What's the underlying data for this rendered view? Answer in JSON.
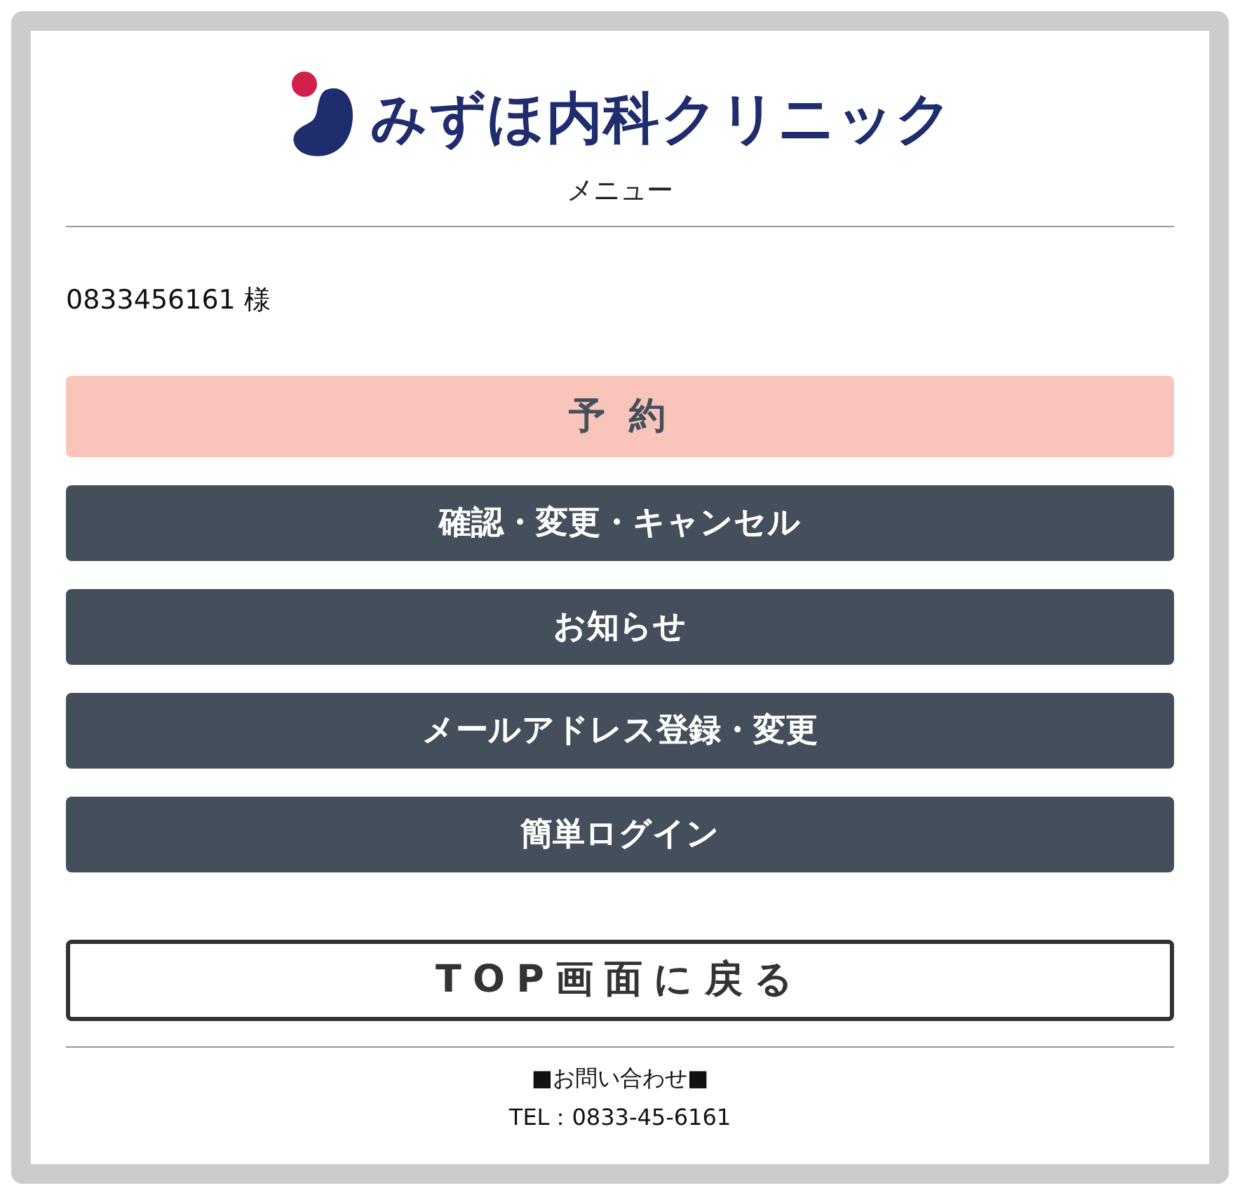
{
  "logo": {
    "name": "みずほ内科クリニック"
  },
  "page_title": "メニュー",
  "user": "0833456161 様",
  "menu": [
    {
      "label": "予 約",
      "kind": "primary"
    },
    {
      "label": "確認・変更・キャンセル",
      "kind": "secondary"
    },
    {
      "label": "お知らせ",
      "kind": "secondary"
    },
    {
      "label": "メールアドレス登録・変更",
      "kind": "secondary"
    },
    {
      "label": "簡単ログイン",
      "kind": "secondary"
    }
  ],
  "top_button": {
    "label": "TOP画面に戻る",
    "kind": "outline"
  },
  "footer": {
    "heading": "■お問い合わせ■",
    "tel": "TEL：0833-45-6161"
  }
}
